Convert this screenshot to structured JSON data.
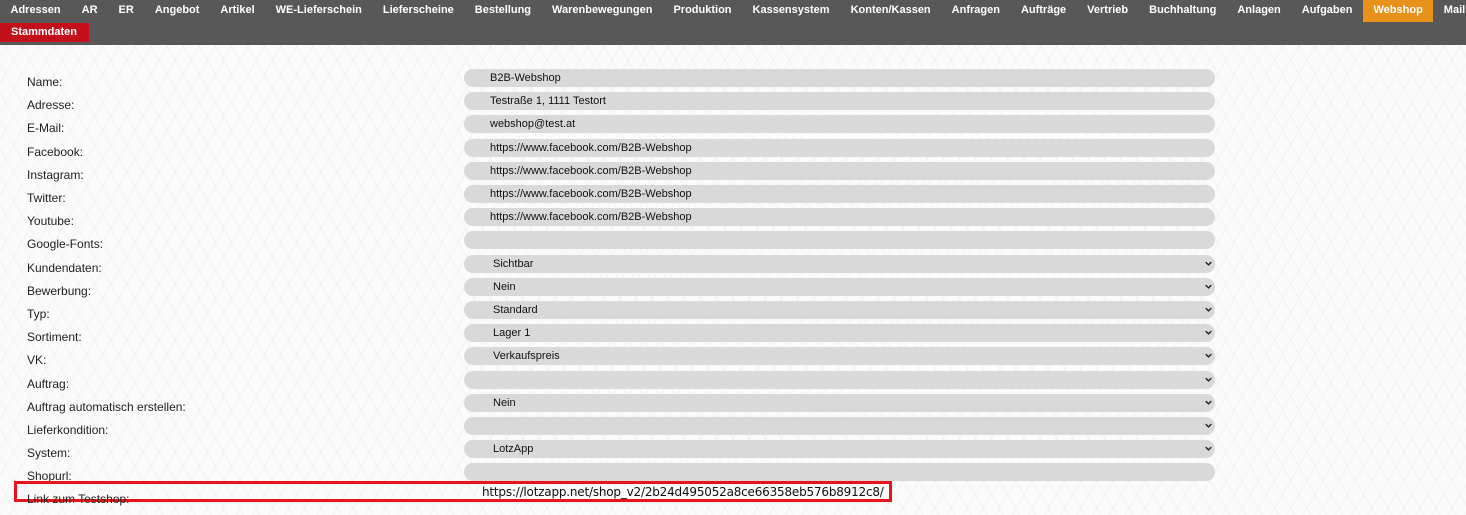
{
  "menu": {
    "items": [
      {
        "label": "Adressen"
      },
      {
        "label": "AR"
      },
      {
        "label": "ER"
      },
      {
        "label": "Angebot"
      },
      {
        "label": "Artikel"
      },
      {
        "label": "WE-Lieferschein"
      },
      {
        "label": "Lieferscheine"
      },
      {
        "label": "Bestellung"
      },
      {
        "label": "Warenbewegungen"
      },
      {
        "label": "Produktion"
      },
      {
        "label": "Kassensystem"
      },
      {
        "label": "Konten/Kassen"
      },
      {
        "label": "Anfragen"
      },
      {
        "label": "Aufträge"
      },
      {
        "label": "Vertrieb"
      },
      {
        "label": "Buchhaltung"
      },
      {
        "label": "Anlagen"
      },
      {
        "label": "Aufgaben"
      },
      {
        "label": "Webshop"
      },
      {
        "label": "Mail"
      }
    ],
    "active_index": 18,
    "active_color": "#e8911b"
  },
  "submenu": {
    "items": [
      {
        "label": "Stammdaten"
      }
    ],
    "color": "#c3101b"
  },
  "form": {
    "rows": [
      {
        "label": "Name:",
        "value": "B2B-Webshop",
        "type": "text"
      },
      {
        "label": "Adresse:",
        "value": "Testraße 1, 1111 Testort",
        "type": "text"
      },
      {
        "label": "E-Mail:",
        "value": "webshop@test.at",
        "type": "text"
      },
      {
        "label": "Facebook:",
        "value": "https://www.facebook.com/B2B-Webshop",
        "type": "text"
      },
      {
        "label": "Instagram:",
        "value": "https://www.facebook.com/B2B-Webshop",
        "type": "text"
      },
      {
        "label": "Twitter:",
        "value": "https://www.facebook.com/B2B-Webshop",
        "type": "text"
      },
      {
        "label": "Youtube:",
        "value": "https://www.facebook.com/B2B-Webshop",
        "type": "text"
      },
      {
        "label": "Google-Fonts:",
        "value": "",
        "type": "text"
      },
      {
        "label": "Kundendaten:",
        "value": "Sichtbar",
        "type": "select"
      },
      {
        "label": "Bewerbung:",
        "value": "Nein",
        "type": "select"
      },
      {
        "label": "Typ:",
        "value": "Standard",
        "type": "select"
      },
      {
        "label": "Sortiment:",
        "value": "Lager 1",
        "type": "select"
      },
      {
        "label": "VK:",
        "value": "Verkaufspreis",
        "type": "select"
      },
      {
        "label": "Auftrag:",
        "value": "",
        "type": "select"
      },
      {
        "label": "Auftrag automatisch erstellen:",
        "value": "Nein",
        "type": "select"
      },
      {
        "label": "Lieferkondition:",
        "value": "",
        "type": "select"
      },
      {
        "label": "System:",
        "value": "LotzApp",
        "type": "select"
      },
      {
        "label": "Shopurl:",
        "value": "",
        "type": "text"
      }
    ],
    "test_link": {
      "label": "Link zum Testshop:",
      "url": "https://lotzapp.net/shop_v2/2b24d495052a8ce66358eb576b8912c8/",
      "highlight_color": "#e8141c"
    }
  }
}
